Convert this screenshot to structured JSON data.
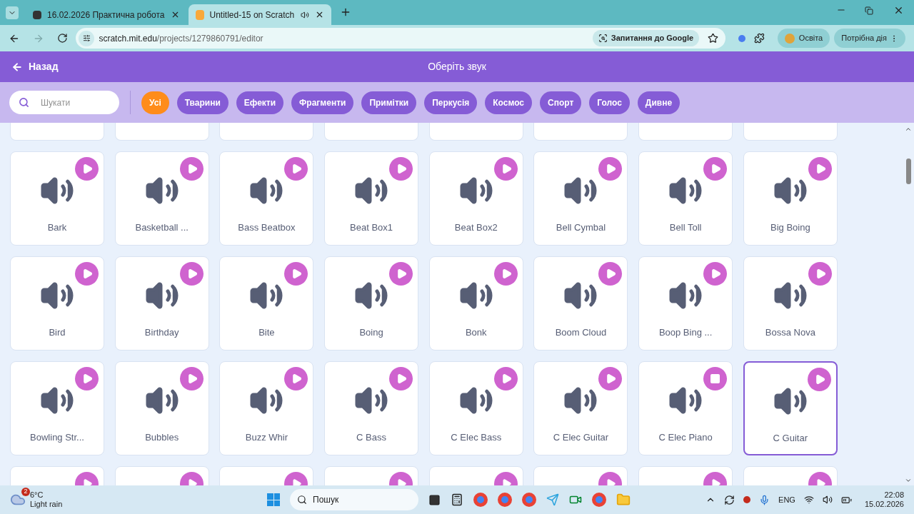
{
  "browser": {
    "tabs": [
      {
        "title": "16.02.2026 Практична робота",
        "selected": false
      },
      {
        "title": "Untitled-15 on Scratch",
        "selected": true
      }
    ],
    "url_host": "scratch.mit.edu",
    "url_path": "/projects/1279860791/editor",
    "lens_button": "Запитання до Google",
    "profile": "Освіта",
    "action_button": "Потрібна дія"
  },
  "header": {
    "back": "Назад",
    "title": "Оберіть звук"
  },
  "search": {
    "placeholder": "Шукати"
  },
  "filters": [
    {
      "label": "Усі",
      "selected": true
    },
    {
      "label": "Тварини",
      "selected": false
    },
    {
      "label": "Ефекти",
      "selected": false
    },
    {
      "label": "Фрагменти",
      "selected": false
    },
    {
      "label": "Примітки",
      "selected": false
    },
    {
      "label": "Перкусія",
      "selected": false
    },
    {
      "label": "Космос",
      "selected": false
    },
    {
      "label": "Спорт",
      "selected": false
    },
    {
      "label": "Голос",
      "selected": false
    },
    {
      "label": "Дивне",
      "selected": false
    }
  ],
  "sounds": [
    {
      "name": "Bark",
      "playing": false,
      "selected": false
    },
    {
      "name": "Basketball ...",
      "playing": false,
      "selected": false
    },
    {
      "name": "Bass Beatbox",
      "playing": false,
      "selected": false
    },
    {
      "name": "Beat Box1",
      "playing": false,
      "selected": false
    },
    {
      "name": "Beat Box2",
      "playing": false,
      "selected": false
    },
    {
      "name": "Bell Cymbal",
      "playing": false,
      "selected": false
    },
    {
      "name": "Bell Toll",
      "playing": false,
      "selected": false
    },
    {
      "name": "Big Boing",
      "playing": false,
      "selected": false
    },
    {
      "name": "Bird",
      "playing": false,
      "selected": false
    },
    {
      "name": "Birthday",
      "playing": false,
      "selected": false
    },
    {
      "name": "Bite",
      "playing": false,
      "selected": false
    },
    {
      "name": "Boing",
      "playing": false,
      "selected": false
    },
    {
      "name": "Bonk",
      "playing": false,
      "selected": false
    },
    {
      "name": "Boom Cloud",
      "playing": false,
      "selected": false
    },
    {
      "name": "Boop Bing ...",
      "playing": false,
      "selected": false
    },
    {
      "name": "Bossa Nova",
      "playing": false,
      "selected": false
    },
    {
      "name": "Bowling Str...",
      "playing": false,
      "selected": false
    },
    {
      "name": "Bubbles",
      "playing": false,
      "selected": false
    },
    {
      "name": "Buzz Whir",
      "playing": false,
      "selected": false
    },
    {
      "name": "C Bass",
      "playing": false,
      "selected": false
    },
    {
      "name": "C Elec Bass",
      "playing": false,
      "selected": false
    },
    {
      "name": "C Elec Guitar",
      "playing": false,
      "selected": false
    },
    {
      "name": "C Elec Piano",
      "playing": true,
      "selected": false
    },
    {
      "name": "C Guitar",
      "playing": false,
      "selected": true
    }
  ],
  "taskbar": {
    "weather_badge": "2",
    "temperature": "6°C",
    "weather": "Light rain",
    "search": "Пошук",
    "language": "ENG",
    "time": "22:08",
    "date": "15.02.2026"
  }
}
